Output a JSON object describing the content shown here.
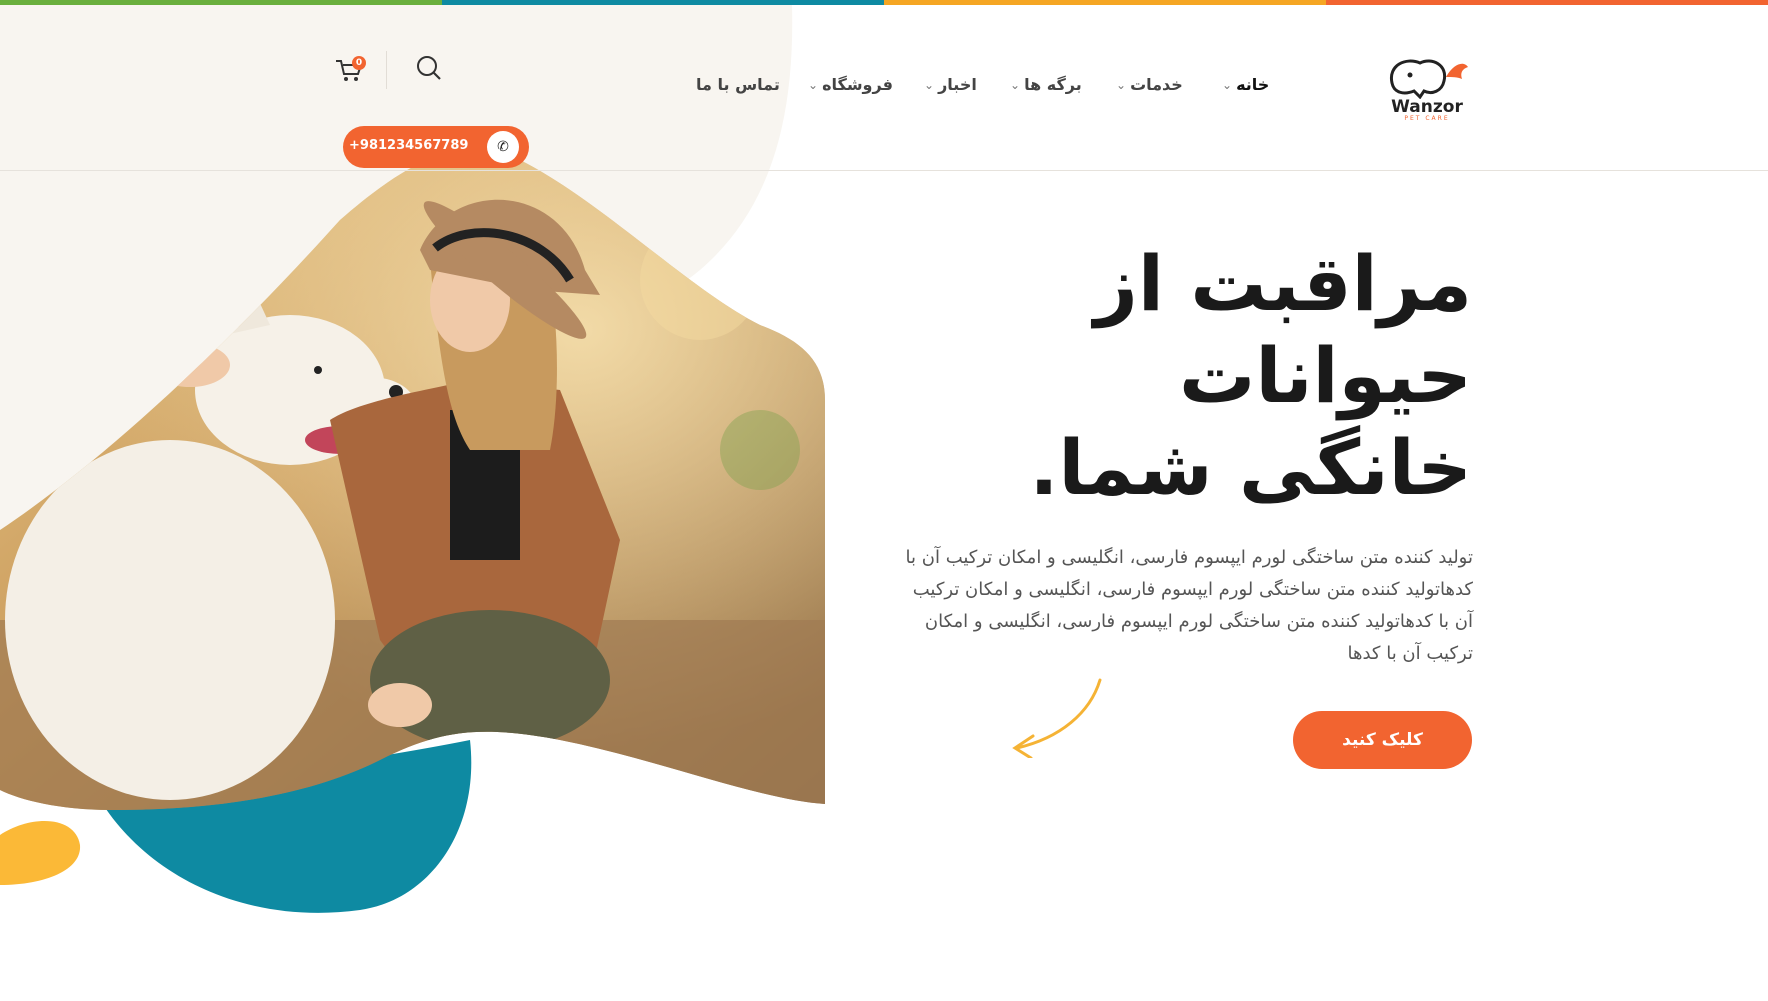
{
  "brand": {
    "name": "Wanzor",
    "tagline": "PET CARE",
    "colors": {
      "orange": "#f26430",
      "teal": "#0e8aa2",
      "yellow": "#fbb937",
      "green": "#6aaf3d",
      "cream": "#f8f5f0",
      "dark": "#1a1a1a"
    }
  },
  "top_bar_colors": [
    "#6aaf3d",
    "#0e8aa2",
    "#f5a623",
    "#f26430"
  ],
  "nav": {
    "items": [
      {
        "label": "خانه",
        "has_dropdown": true,
        "active": true
      },
      {
        "label": "خدمات",
        "has_dropdown": true,
        "active": false
      },
      {
        "label": "برگه ها",
        "has_dropdown": true,
        "active": false
      },
      {
        "label": "اخبار",
        "has_dropdown": true,
        "active": false
      },
      {
        "label": "فروشگاه",
        "has_dropdown": true,
        "active": false
      },
      {
        "label": "تماس با ما",
        "has_dropdown": false,
        "active": false
      }
    ],
    "chevron": "⌄"
  },
  "header": {
    "search_icon": "search-icon",
    "cart_icon": "cart-icon",
    "cart_count": "0",
    "phone_number": "+981234567789",
    "phone_icon": "phone-icon"
  },
  "hero": {
    "title_lines": [
      "مراقبت از",
      "حیوانات",
      "خانگی شما."
    ],
    "description": "تولید کننده متن ساختگی لورم ایپسوم فارسی، انگلیسی و امکان ترکیب آن با کدهاتولید کننده متن ساختگی لورم ایپسوم فارسی، انگلیسی و امکان ترکیب آن با کدهاتولید کننده متن ساختگی لورم ایپسوم فارسی، انگلیسی و امکان ترکیب آن با کدها",
    "cta_label": "کلیک کنید",
    "image": "woman-with-white-dog-photo"
  }
}
